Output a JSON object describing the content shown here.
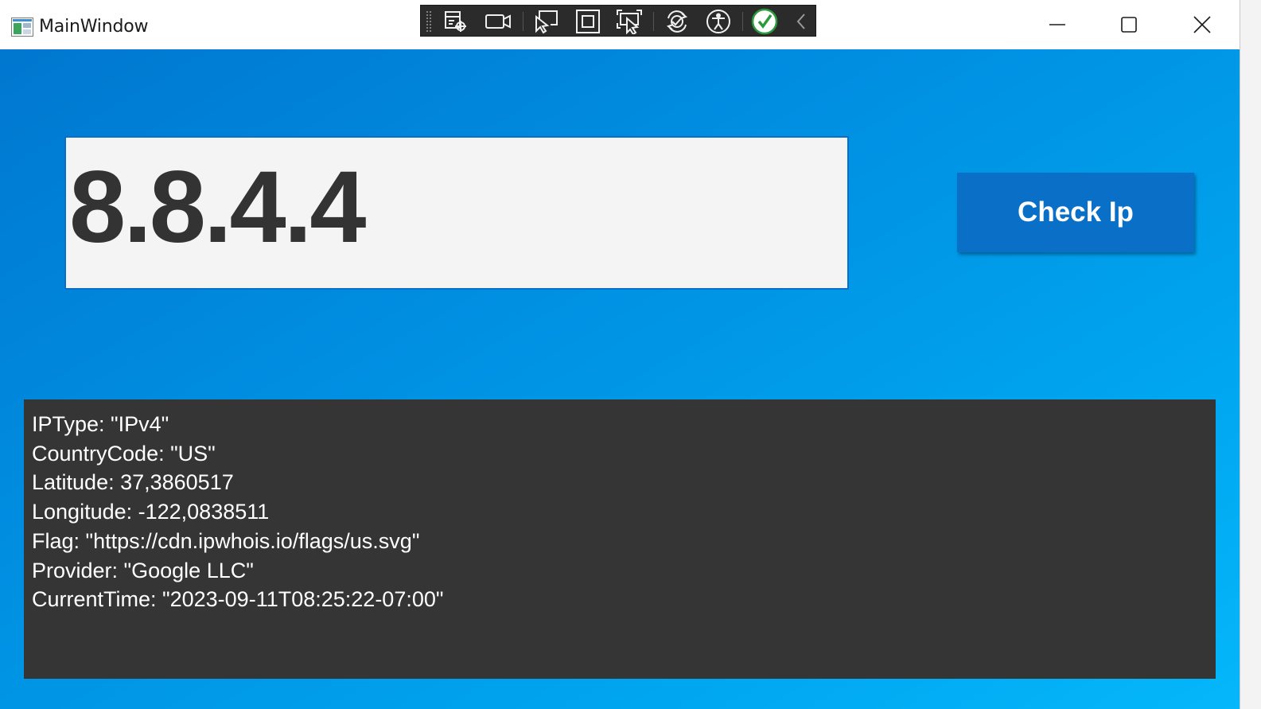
{
  "window": {
    "title": "MainWindow",
    "caption_buttons": {
      "minimize_icon": "minimize-icon",
      "maximize_icon": "maximize-icon",
      "close_icon": "close-icon"
    }
  },
  "debug_toolbar": {
    "items": [
      "live-visual-tree-icon",
      "record-icon",
      "select-element-icon",
      "display-layout-adorners-icon",
      "track-focused-element-icon",
      "hot-reload-icon",
      "accessibility-checker-icon",
      "binding-ok-icon",
      "collapse-chevron-icon"
    ]
  },
  "ip_input": {
    "value": "8.8.4.4"
  },
  "check_button": {
    "label": "Check Ip"
  },
  "result": {
    "lines": [
      "IPType: \"IPv4\"",
      "CountryCode: \"US\"",
      "Latitude: 37,3860517",
      "Longitude: -122,0838511",
      "Flag: \"https://cdn.ipwhois.io/flags/us.svg\"",
      "Provider: \"Google LLC\"",
      "CurrentTime: \"2023-09-11T08:25:22-07:00\""
    ]
  },
  "colors": {
    "client_gradient_start": "#0077d0",
    "client_gradient_end": "#05b7fb",
    "button_bg": "#0a70c7",
    "panel_bg": "#353535",
    "input_bg": "#f4f4f4",
    "ip_text": "#333333"
  }
}
